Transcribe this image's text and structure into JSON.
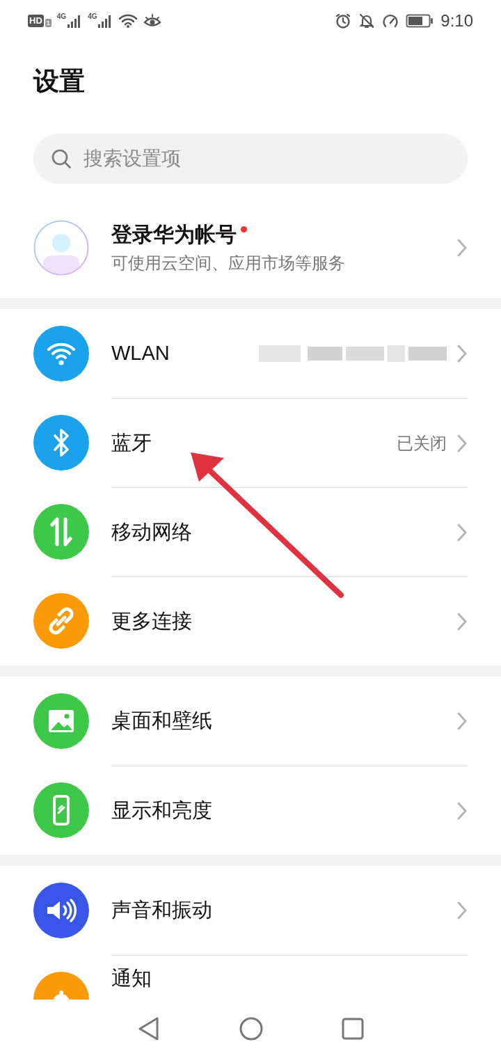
{
  "status_bar": {
    "hd": "HD",
    "sim": "1",
    "networks": [
      "4G",
      "4G"
    ],
    "time": "9:10"
  },
  "title": "设置",
  "search": {
    "placeholder": "搜索设置项"
  },
  "account": {
    "title": "登录华为帐号",
    "subtitle": "可使用云空间、应用市场等服务",
    "badge": true
  },
  "groups": [
    [
      {
        "kind": "wifi",
        "label": "WLAN",
        "color": "#1aa3ec",
        "value_blurred": true
      },
      {
        "kind": "bluetooth",
        "label": "蓝牙",
        "color": "#1aa3ec",
        "value": "已关闭"
      },
      {
        "kind": "mobile",
        "label": "移动网络",
        "color": "#3ec84a"
      },
      {
        "kind": "link",
        "label": "更多连接",
        "color": "#fd9a08"
      }
    ],
    [
      {
        "kind": "wallpaper",
        "label": "桌面和壁纸",
        "color": "#3ec84a"
      },
      {
        "kind": "display",
        "label": "显示和亮度",
        "color": "#3ec84a"
      }
    ],
    [
      {
        "kind": "sound",
        "label": "声音和振动",
        "color": "#3a56e8"
      },
      {
        "kind": "bell",
        "label": "通知",
        "color": "#fd9a08",
        "cut_off": true
      }
    ]
  ]
}
